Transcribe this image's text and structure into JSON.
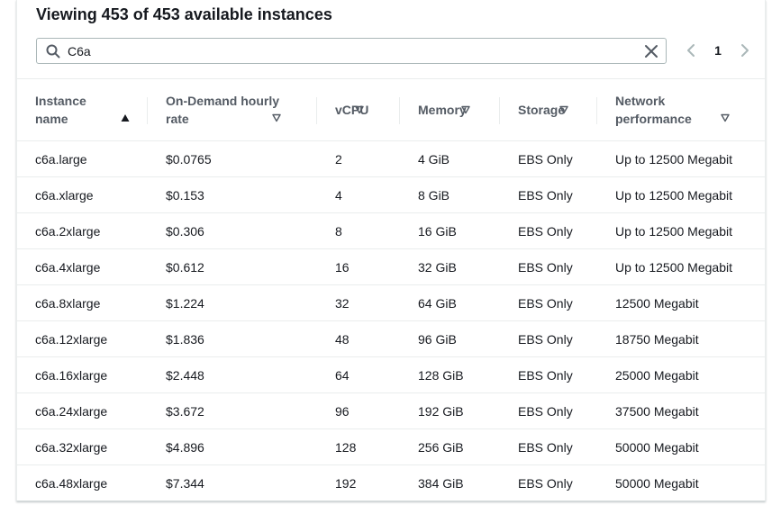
{
  "heading": "Viewing 453 of 453 available instances",
  "search": {
    "value": "C6a",
    "placeholder": ""
  },
  "pagination": {
    "current_page": "1"
  },
  "table": {
    "columns": [
      {
        "label": "Instance name",
        "sort": "ascending"
      },
      {
        "label": "On-Demand hourly rate",
        "sort": "none"
      },
      {
        "label": "vCPU",
        "sort": "none"
      },
      {
        "label": "Memory",
        "sort": "none"
      },
      {
        "label": "Storage",
        "sort": "none"
      },
      {
        "label": "Network performance",
        "sort": "none"
      }
    ],
    "rows": [
      [
        "c6a.large",
        "$0.0765",
        "2",
        "4 GiB",
        "EBS Only",
        "Up to 12500 Megabit"
      ],
      [
        "c6a.xlarge",
        "$0.153",
        "4",
        "8 GiB",
        "EBS Only",
        "Up to 12500 Megabit"
      ],
      [
        "c6a.2xlarge",
        "$0.306",
        "8",
        "16 GiB",
        "EBS Only",
        "Up to 12500 Megabit"
      ],
      [
        "c6a.4xlarge",
        "$0.612",
        "16",
        "32 GiB",
        "EBS Only",
        "Up to 12500 Megabit"
      ],
      [
        "c6a.8xlarge",
        "$1.224",
        "32",
        "64 GiB",
        "EBS Only",
        "12500 Megabit"
      ],
      [
        "c6a.12xlarge",
        "$1.836",
        "48",
        "96 GiB",
        "EBS Only",
        "18750 Megabit"
      ],
      [
        "c6a.16xlarge",
        "$2.448",
        "64",
        "128 GiB",
        "EBS Only",
        "25000 Megabit"
      ],
      [
        "c6a.24xlarge",
        "$3.672",
        "96",
        "192 GiB",
        "EBS Only",
        "37500 Megabit"
      ],
      [
        "c6a.32xlarge",
        "$4.896",
        "128",
        "256 GiB",
        "EBS Only",
        "50000 Megabit"
      ],
      [
        "c6a.48xlarge",
        "$7.344",
        "192",
        "384 GiB",
        "EBS Only",
        "50000 Megabit"
      ]
    ]
  },
  "icons": {
    "search": "search-icon",
    "clear": "close-icon",
    "prev": "chevron-left-icon",
    "next": "chevron-right-icon",
    "sort_ascending": "caret-up-filled-icon",
    "sort_none": "caret-down-outline-icon"
  },
  "colors": {
    "text": "#16191f",
    "header_text": "#545b64",
    "border": "#eaeded",
    "input_border": "#aab7b8",
    "disabled_arrow": "#aab7b8"
  }
}
